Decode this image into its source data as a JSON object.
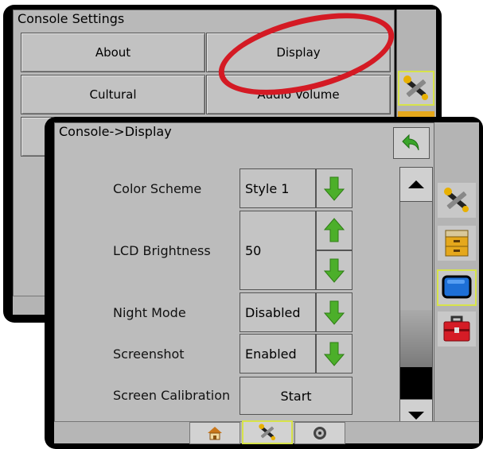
{
  "background_window": {
    "title": "Console Settings",
    "buttons": [
      "About",
      "Display",
      "Cultural",
      "Audio Volume"
    ]
  },
  "foreground_window": {
    "title": "Console->Display",
    "rows": [
      {
        "label": "Color Scheme",
        "value": "Style 1"
      },
      {
        "label": "LCD Brightness",
        "value": "50"
      },
      {
        "label": "Night Mode",
        "value": "Disabled"
      },
      {
        "label": "Screenshot",
        "value": "Enabled"
      },
      {
        "label": "Screen Calibration",
        "button": "Start"
      }
    ]
  },
  "icons": {
    "back": "back-arrow-icon",
    "tools": "tools-icon",
    "file_cabinet": "file-cabinet-icon",
    "display": "display-icon",
    "toolbox": "toolbox-icon",
    "home": "home-icon",
    "gnss": "gnss-icon",
    "arrow_up": "arrow-up-icon",
    "arrow_down": "arrow-down-icon"
  },
  "colors": {
    "highlight": "#d41a24",
    "arrow_green": "#4caf2a",
    "selected_outline": "#d7e34a"
  }
}
